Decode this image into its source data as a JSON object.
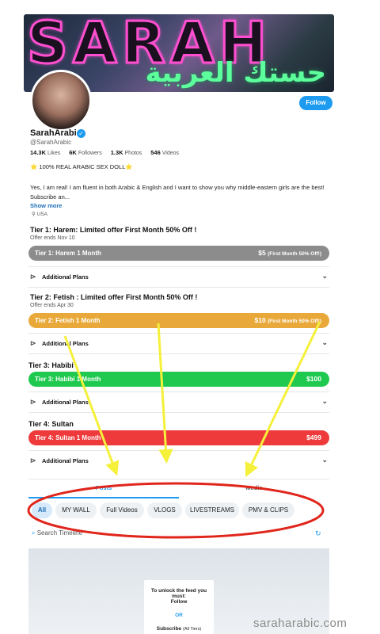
{
  "banner": {
    "title": "SARAH",
    "arabic": "حستك العربية"
  },
  "profile": {
    "name": "SarahArabic",
    "handle": "@SarahArabic",
    "follow_label": "Follow",
    "stats": [
      {
        "value": "14.3K",
        "label": "Likes"
      },
      {
        "value": "6K",
        "label": "Followers"
      },
      {
        "value": "1.3K",
        "label": "Photos"
      },
      {
        "value": "546",
        "label": "Videos"
      }
    ],
    "tagline": "⭐ 100% REAL ARABIC SEX DOLL⭐",
    "bio": "Yes, I am real!  I am fluent in both Arabic & English and I want to show you why middle-eastern girls are the best! Subscribe an...",
    "show_more": "Show more",
    "location": "USA"
  },
  "tiers": [
    {
      "title": "Tier 1: Harem: Limited offer First Month 50% Off !",
      "offer": "Offer ends Nov 10",
      "bar_label": "Tier 1: Harem 1 Month",
      "price": "$5",
      "price_note": "(First Month 50% Off!)",
      "color": "#8c8c8c"
    },
    {
      "title": "Tier 2: Fetish : Limited offer First Month 50% Off !",
      "offer": "Offer ends Apr 30",
      "bar_label": "Tier 2: Fetish 1 Month",
      "price": "$10",
      "price_note": "(First Month 50% Off!)",
      "color": "#e9a93a"
    },
    {
      "title": "Tier 3: Habibi",
      "offer": "",
      "bar_label": "Tier 3: Habibi 1 Month",
      "price": "$100",
      "price_note": "",
      "color": "#1fc94f"
    },
    {
      "title": "Tier 4: Sultan",
      "offer": "",
      "bar_label": "Tier 4: Sultan 1 Month",
      "price": "$499",
      "price_note": "",
      "color": "#ee3a3a"
    }
  ],
  "additional_plans": "Additional Plans",
  "tabs": [
    "Posts",
    "Media"
  ],
  "filters": [
    "All",
    "MY WALL",
    "Full Videos",
    "VLOGS",
    "LIVESTREAMS",
    "PMV & CLIPS"
  ],
  "search_placeholder": "Search Timeline",
  "lock": {
    "heading": "To unlock the feed you must:",
    "follow": "Follow",
    "or": "OR",
    "subscribe": "Subscribe",
    "subscribe_note": "(All Tiers)"
  },
  "watermark": "saraharabic.com",
  "colors": {
    "accent": "#1d9bf0",
    "annotation_arrow": "#f5f03a",
    "annotation_ellipse": "#e0251b"
  }
}
